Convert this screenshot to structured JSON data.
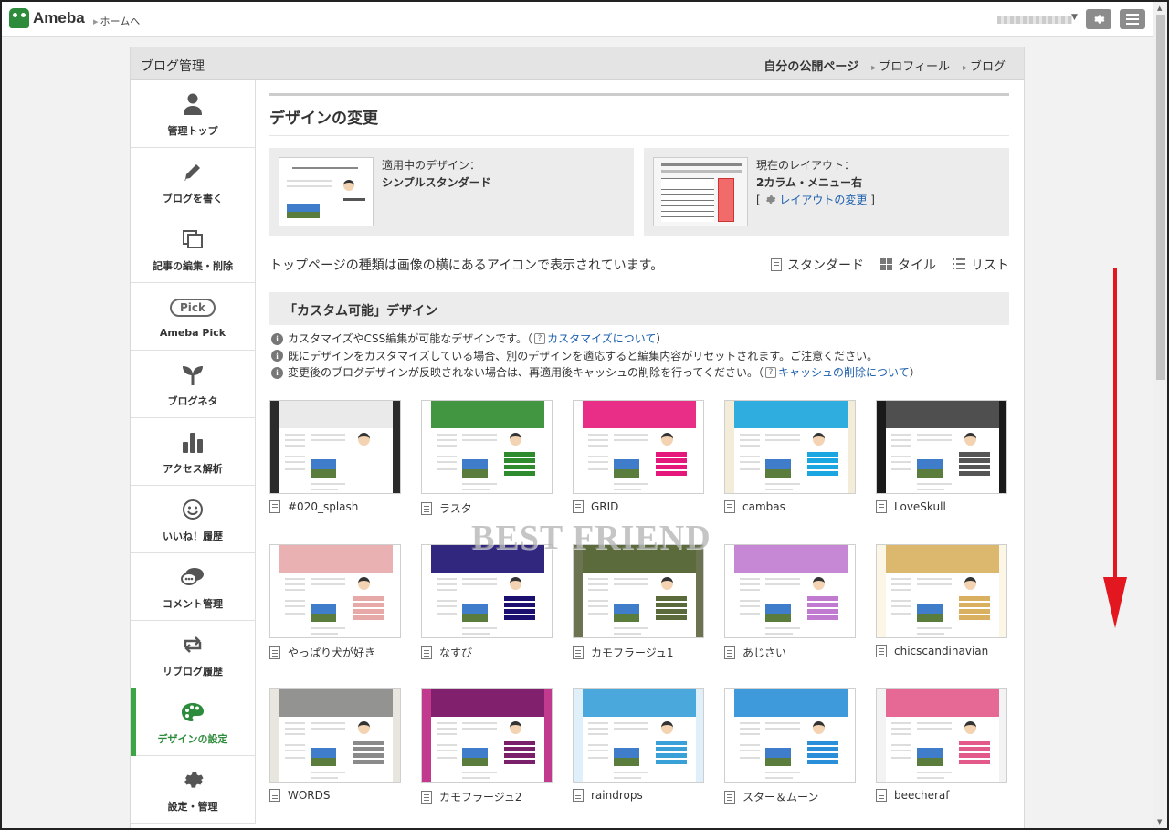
{
  "topbar": {
    "brand": "Ameba",
    "home_link": "ホームへ",
    "settings_icon": "gear-icon",
    "menu_icon": "hamburger-icon"
  },
  "panel": {
    "title": "ブログ管理",
    "links": {
      "own_page": "自分の公開ページ",
      "profile": "プロフィール",
      "blog": "ブログ"
    }
  },
  "sidebar": {
    "items": [
      {
        "label": "管理トップ",
        "icon": "person-icon"
      },
      {
        "label": "ブログを書く",
        "icon": "pencil-icon"
      },
      {
        "label": "記事の編集・削除",
        "icon": "documents-icon"
      },
      {
        "label": "Ameba Pick",
        "icon": "pick-icon",
        "pill": "Pick"
      },
      {
        "label": "ブログネタ",
        "icon": "sprout-icon"
      },
      {
        "label": "アクセス解析",
        "icon": "bar-chart-icon"
      },
      {
        "label": "いいね！履歴",
        "icon": "smiley-icon"
      },
      {
        "label": "コメント管理",
        "icon": "comment-icon"
      },
      {
        "label": "リブログ履歴",
        "icon": "reblog-icon"
      },
      {
        "label": "デザインの設定",
        "icon": "palette-icon",
        "active": true
      },
      {
        "label": "設定・管理",
        "icon": "gear-icon"
      }
    ]
  },
  "main": {
    "title": "デザインの変更",
    "current_design": {
      "label": "適用中のデザイン：",
      "name": "シンプルスタンダード"
    },
    "current_layout": {
      "label": "現在のレイアウト：",
      "name": "2カラム・メニュー右",
      "bracket_open": "[",
      "change_link": "レイアウトの変更",
      "bracket_close": "]"
    },
    "top_type_text": "トップページの種類は画像の横にあるアイコンで表示されています。",
    "type_options": {
      "standard": "スタンダード",
      "tile": "タイル",
      "list": "リスト"
    },
    "section_title": "「カスタム可能」デザイン",
    "notes": {
      "n1_text": "カスタマイズやCSS編集が可能なデザインです。（",
      "n1_link": "カスタマイズについて",
      "n1_close": "）",
      "n2_text": "既にデザインをカスタマイズしている場合、別のデザインを適応すると編集内容がリセットされます。ご注意ください。",
      "n3_text": "変更後のブログデザインが反映されない場合は、再適用後キャッシュの削除を行ってください。（",
      "n3_link": "キャッシュの削除について",
      "n3_close": "）"
    },
    "designs": [
      {
        "name": "#020_splash",
        "theme": "#2b2b2b",
        "accent": "#ffffff"
      },
      {
        "name": "ラスタ",
        "theme": "#ffffff",
        "accent": "#2e8b2e"
      },
      {
        "name": "GRID",
        "theme": "#ffffff",
        "accent": "#e6177a"
      },
      {
        "name": "cambas",
        "theme": "#f3ecd8",
        "accent": "#1aa6e0"
      },
      {
        "name": "LoveSkull",
        "theme": "#1a1a1a",
        "accent": "#555555"
      },
      {
        "name": "やっぱり犬が好き",
        "theme": "#ffffff",
        "accent": "#e7a8a8"
      },
      {
        "name": "なすび",
        "theme": "#ffffff",
        "accent": "#1b1070"
      },
      {
        "name": "カモフラージュ1",
        "theme": "#6b7350",
        "accent": "#5a6a3a"
      },
      {
        "name": "あじさい",
        "theme": "#ffffff",
        "accent": "#c07ad0"
      },
      {
        "name": "chicscandinavian",
        "theme": "#fbf6e6",
        "accent": "#d8b060"
      },
      {
        "name": "WORDS",
        "theme": "#e8e6df",
        "accent": "#8a8a8a"
      },
      {
        "name": "カモフラージュ2",
        "theme": "#c23a8e",
        "accent": "#7a1f6a"
      },
      {
        "name": "raindrops",
        "theme": "#dff0fb",
        "accent": "#3aa0d8"
      },
      {
        "name": "スター＆ムーン",
        "theme": "#ffffff",
        "accent": "#2a8fd8"
      },
      {
        "name": "beecheraf",
        "theme": "#f3f3f3",
        "accent": "#e35a8a"
      }
    ]
  },
  "watermark": "BEST FRIEND",
  "colors": {
    "active_green": "#3ca645",
    "link_blue": "#1d5fae",
    "annotation_red": "#e3171f"
  }
}
